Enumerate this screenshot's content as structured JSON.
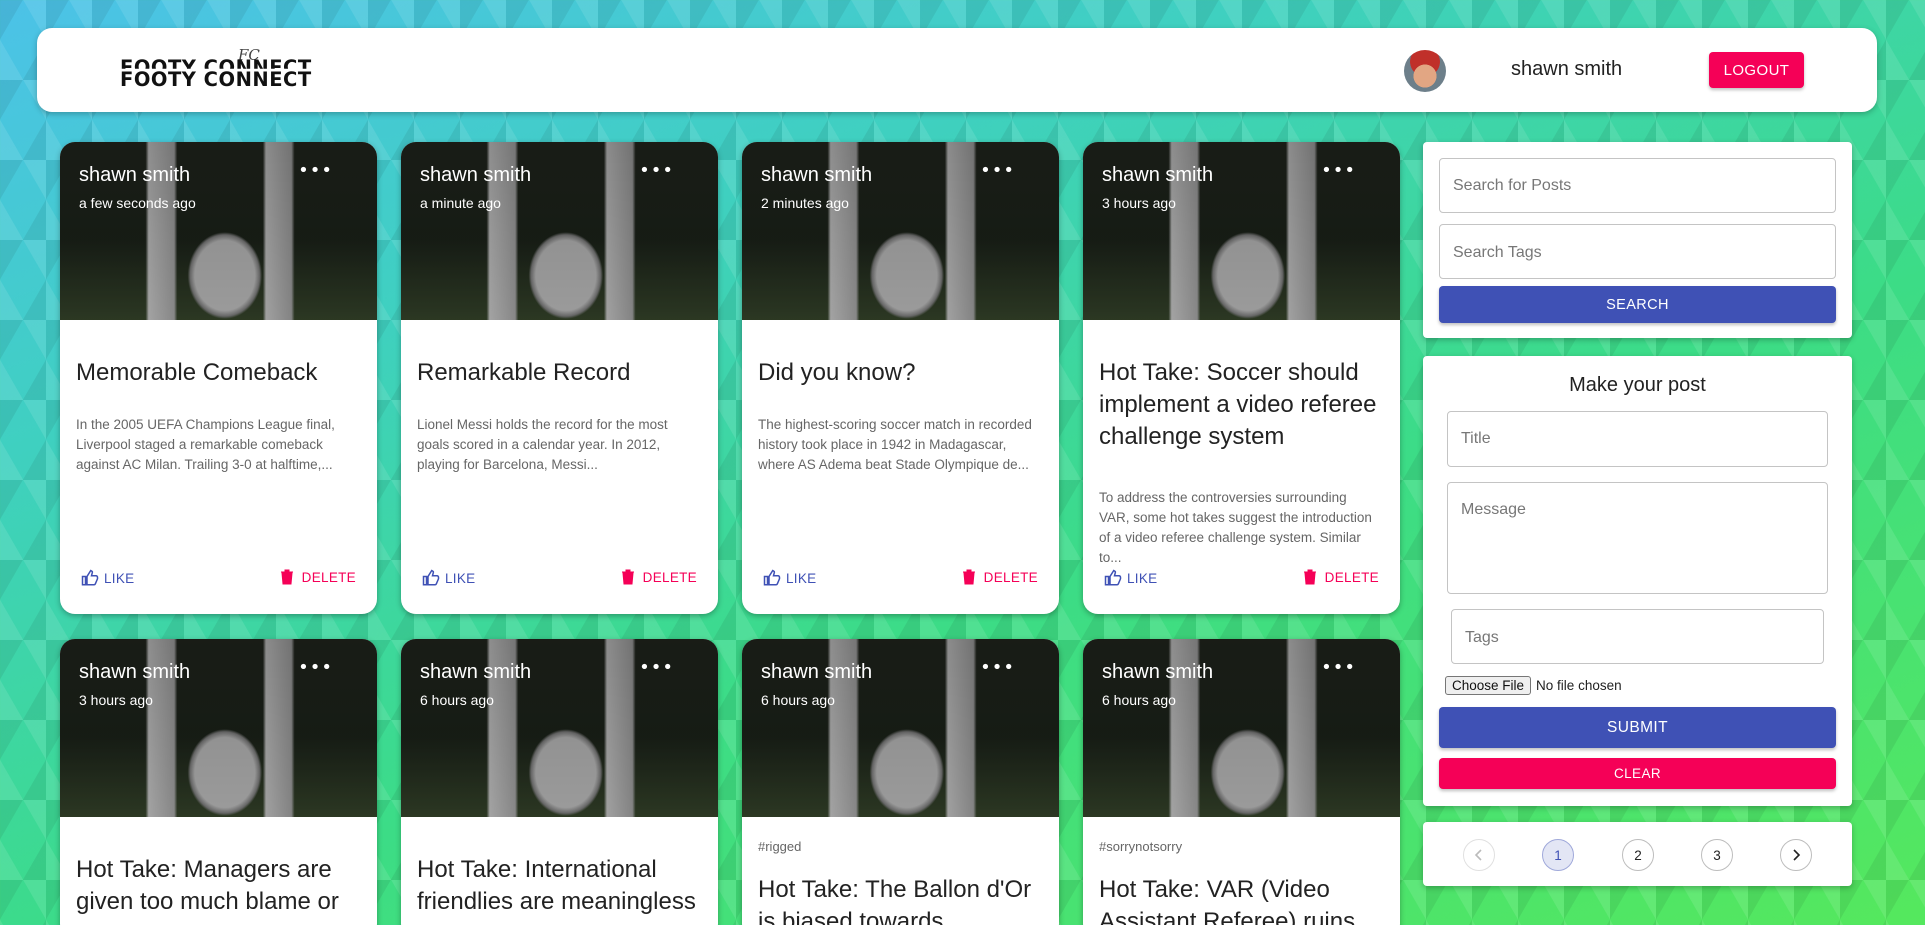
{
  "header": {
    "logo_text": "FOOTY CONNECT",
    "logo_signature": "FC",
    "user_name": "shawn smith",
    "logout_label": "LOGOUT"
  },
  "posts": [
    {
      "author": "shawn smith",
      "time": "a few seconds ago",
      "tags": "",
      "title": "Memorable Comeback",
      "message": "In the 2005 UEFA Champions League final, Liverpool staged a remarkable comeback against AC Milan. Trailing 3-0 at halftime,...",
      "like_label": "LIKE",
      "delete_label": "DELETE"
    },
    {
      "author": "shawn smith",
      "time": "a minute ago",
      "tags": "",
      "title": "Remarkable Record",
      "message": "Lionel Messi holds the record for the most goals scored in a calendar year. In 2012, playing for Barcelona, Messi...",
      "like_label": "LIKE",
      "delete_label": "DELETE"
    },
    {
      "author": "shawn smith",
      "time": "2 minutes ago",
      "tags": "",
      "title": "Did you know?",
      "message": "The highest-scoring soccer match in recorded history took place in 1942 in Madagascar, where AS Adema beat Stade Olympique de...",
      "like_label": "LIKE",
      "delete_label": "DELETE"
    },
    {
      "author": "shawn smith",
      "time": "3 hours ago",
      "tags": "",
      "title": "Hot Take: Soccer should implement a video referee challenge system",
      "message": "To address the controversies surrounding VAR, some hot takes suggest the introduction of a video referee challenge system. Similar to...",
      "like_label": "LIKE",
      "delete_label": "DELETE"
    },
    {
      "author": "shawn smith",
      "time": "3 hours ago",
      "tags": "",
      "title": "Hot Take: Managers are given too much blame or"
    },
    {
      "author": "shawn smith",
      "time": "6 hours ago",
      "tags": "",
      "title": "Hot Take: International friendlies are meaningless"
    },
    {
      "author": "shawn smith",
      "time": "6 hours ago",
      "tags": "#rigged",
      "title": "Hot Take: The Ballon d'Or is biased towards"
    },
    {
      "author": "shawn smith",
      "time": "6 hours ago",
      "tags": "#sorrynotsorry",
      "title": "Hot Take: VAR (Video Assistant Referee) ruins"
    }
  ],
  "search": {
    "posts_placeholder": "Search for Posts",
    "tags_placeholder": "Search Tags",
    "button_label": "SEARCH"
  },
  "form": {
    "heading": "Make your post",
    "title_placeholder": "Title",
    "message_placeholder": "Message",
    "tags_placeholder": "Tags",
    "choose_file_label": "Choose File",
    "file_status": "No file chosen",
    "submit_label": "SUBMIT",
    "clear_label": "CLEAR"
  },
  "pagination": {
    "pages": [
      "1",
      "2",
      "3"
    ],
    "current_page": "1",
    "prev_icon": "chevron-left-icon",
    "next_icon": "chevron-right-icon"
  },
  "colors": {
    "primary": "#3f51b5",
    "secondary": "#f50057"
  }
}
